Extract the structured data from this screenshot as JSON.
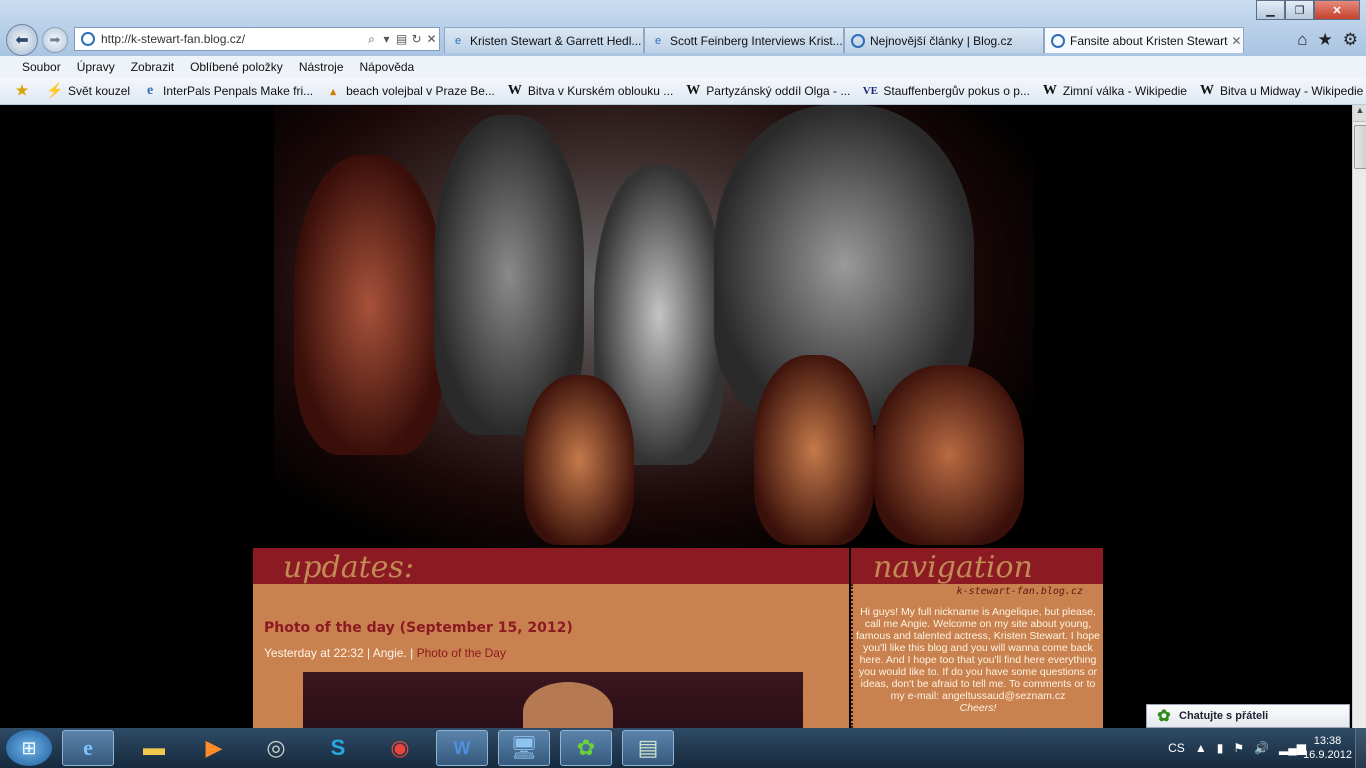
{
  "browser": {
    "address": "http://k-stewart-fan.blog.cz/",
    "tabs": [
      {
        "label": "Kristen Stewart & Garrett Hedl..."
      },
      {
        "label": "Scott Feinberg Interviews Krist..."
      },
      {
        "label": "Nejnovější články | Blog.cz"
      },
      {
        "label": "Fansite about Kristen Stewart"
      }
    ],
    "menu": [
      "Soubor",
      "Úpravy",
      "Zobrazit",
      "Oblíbené položky",
      "Nástroje",
      "Nápověda"
    ],
    "favorites": [
      {
        "label": "Svět kouzel",
        "icon": "lightning-icon"
      },
      {
        "label": "InterPals Penpals  Make fri...",
        "icon": "ie-icon"
      },
      {
        "label": "beach volejbal v Praze  Be...",
        "icon": "page-icon"
      },
      {
        "label": "Bitva v Kurském oblouku ...",
        "icon": "wikipedia-icon"
      },
      {
        "label": "Partyzánský oddíl Olga - ...",
        "icon": "wikipedia-icon"
      },
      {
        "label": "Stauffenbergův pokus o p...",
        "icon": "ve-icon"
      },
      {
        "label": "Zimní válka - Wikipedie",
        "icon": "wikipedia-icon"
      },
      {
        "label": "Bitva u Midway - Wikipedie",
        "icon": "wikipedia-icon"
      }
    ]
  },
  "page": {
    "updates_heading": "updates:",
    "navigation_heading": "navigation",
    "blog_url": "k-stewart-fan.blog.cz",
    "post": {
      "title": "Photo of the day (September 15, 2012)",
      "meta": "Yesterday at 22:32 | Angie. | ",
      "category": "Photo of the Day"
    },
    "welcome": "Hi guys! My full nickname is Angelique, but please, call me Angie. Welcome on my site about young, famous and talented actress, Kristen Stewart. I hope you'll like this blog and you will wanna come back here. And I hope too that you'll find here everything you would like to. If do you have some questions or ideas, don't be afraid to tell me. To comments or to my e-mail: angeltussaud@seznam.cz",
    "cheers": "Cheers!"
  },
  "chat_popup": "Chatujte s přáteli",
  "taskbar": {
    "lang": "CS",
    "time": "13:38",
    "date": "16.9.2012"
  },
  "colors": {
    "accent_red": "#8c1a22",
    "content_bg": "#c9824f"
  }
}
